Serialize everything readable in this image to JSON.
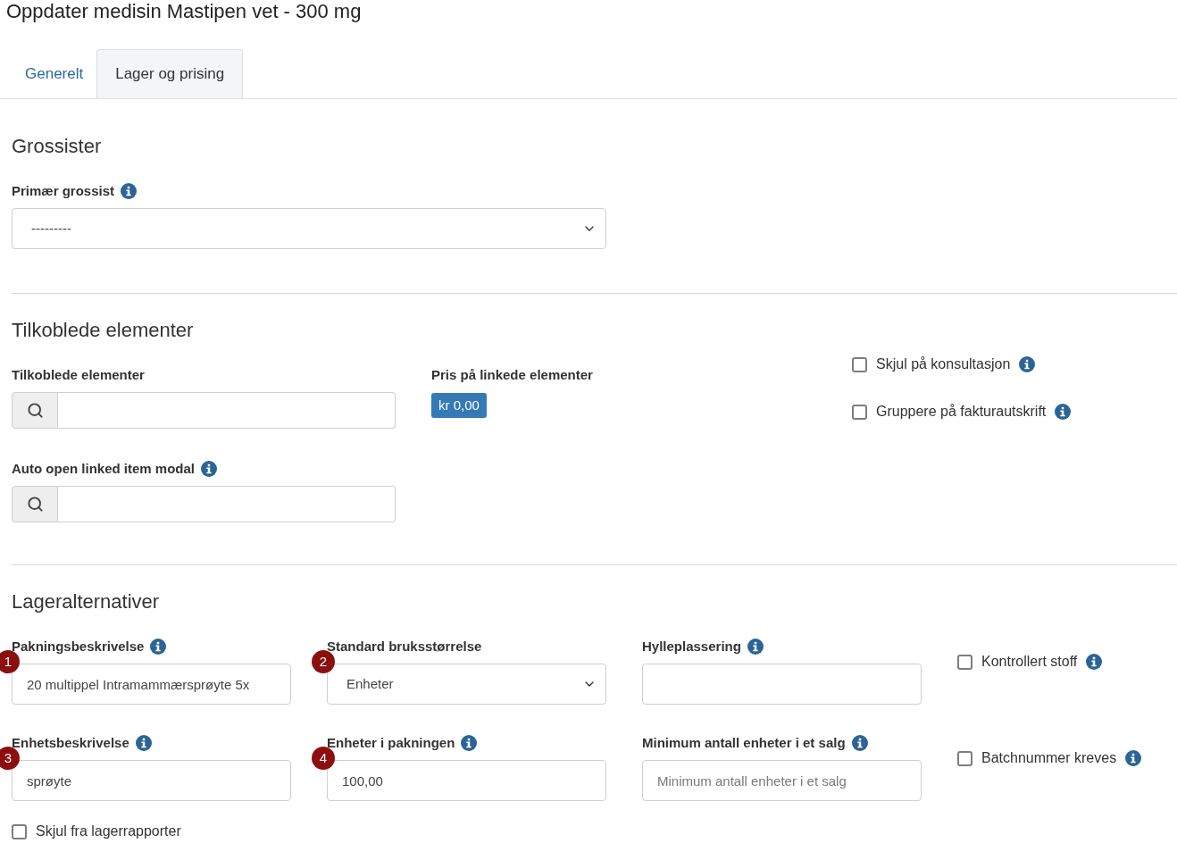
{
  "title": "Oppdater medisin Mastipen vet - 300 mg",
  "tabs": [
    {
      "label": "Generelt",
      "selected": false
    },
    {
      "label": "Lager og prising",
      "selected": true
    }
  ],
  "wholesalers": {
    "heading": "Grossister",
    "primary_wholesaler": {
      "label": "Primær grossist",
      "has_info": true,
      "value": "---------"
    }
  },
  "linked_items": {
    "heading": "Tilkoblede elementer",
    "search": {
      "label": "Tilkoblede elementer",
      "has_info": false
    },
    "auto_open": {
      "label": "Auto open linked item modal",
      "has_info": true
    },
    "price": {
      "label": "Pris på linkede elementer",
      "has_info": false,
      "amount": "kr 0,00"
    },
    "options": [
      {
        "label": "Skjul på konsultasjon",
        "has_info": true,
        "checked": false
      },
      {
        "label": "Gruppere på fakturautskrift",
        "has_info": true,
        "checked": false
      }
    ]
  },
  "stock_options": {
    "heading": "Lageralternativer",
    "fields": [
      {
        "kind": "text",
        "label": "Pakningsbeskrivelse",
        "has_info": true,
        "marker": "1",
        "value": "20 multippel Intramammærsprøyte 5x"
      },
      {
        "kind": "select",
        "label": "Standard bruksstørrelse",
        "has_info": false,
        "marker": "2",
        "value": "Enheter"
      },
      {
        "kind": "text",
        "label": "Hylleplassering",
        "has_info": true
      },
      {
        "kind": "checkbox",
        "label": "Kontrollert stoff",
        "has_info": true,
        "checked": false
      },
      {
        "kind": "text",
        "label": "Enhetsbeskrivelse",
        "has_info": true,
        "marker": "3",
        "value": "sprøyte"
      },
      {
        "kind": "text",
        "label": "Enheter i pakningen",
        "has_info": true,
        "marker": "4",
        "value": "100,00"
      },
      {
        "kind": "text",
        "label": "Minimum antall enheter i et salg",
        "has_info": true,
        "placeholder": "Minimum antall enheter i et salg"
      },
      {
        "kind": "checkbox",
        "label": "Batchnummer kreves",
        "has_info": true,
        "checked": false
      }
    ],
    "hide_from_reports": {
      "label": "Skjul fra lagerrapporter",
      "has_info": false,
      "checked": false
    }
  }
}
